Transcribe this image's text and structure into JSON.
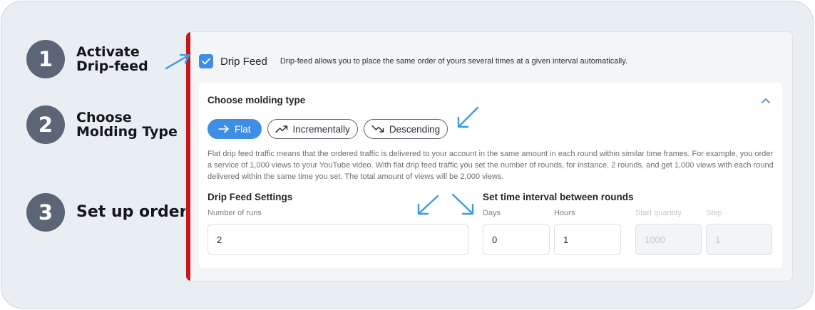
{
  "steps": [
    {
      "number": "1",
      "line1": "Activate",
      "line2": "Drip-feed"
    },
    {
      "number": "2",
      "line1": "Choose",
      "line2": "Molding Type"
    },
    {
      "number": "3",
      "line1": "Set up order",
      "line2": ""
    }
  ],
  "drip_feed": {
    "checked": true,
    "title": "Drip Feed",
    "description": "Drip-feed allows you to place the same order of yours several times at a given interval automatically."
  },
  "molding": {
    "title": "Choose molding type",
    "expanded": true,
    "types": [
      {
        "label": "Flat",
        "icon": "arrow-right-icon",
        "active": true
      },
      {
        "label": "Incrementally",
        "icon": "trend-up-icon",
        "active": false
      },
      {
        "label": "Descending",
        "icon": "trend-down-icon",
        "active": false
      }
    ],
    "description": "Flat drip feed traffic means that the ordered traffic is delivered to your account in the same amount in each round within similar time frames. For example, you order a service of 1,000 views to your YouTube video. With flat drip feed traffic you set the number of rounds, for instance, 2 rounds, and get 1,000 views with each round delivered within the same time you set. The total amount of views will be 2,000 views."
  },
  "settings": {
    "title": "Drip Feed Settings",
    "runs_label": "Number of runs",
    "runs_value": "2"
  },
  "interval": {
    "title": "Set time interval between rounds",
    "days_label": "Days",
    "days_value": "0",
    "hours_label": "Hours",
    "hours_value": "1",
    "start_label": "Start quantity",
    "start_placeholder": "1000",
    "step_label": "Step",
    "step_placeholder": "1"
  },
  "colors": {
    "accent": "#3f8ee6",
    "step_circle": "#5b6575",
    "panel_bar": "#c4161c",
    "annotation_arrow": "#3a9be0"
  }
}
